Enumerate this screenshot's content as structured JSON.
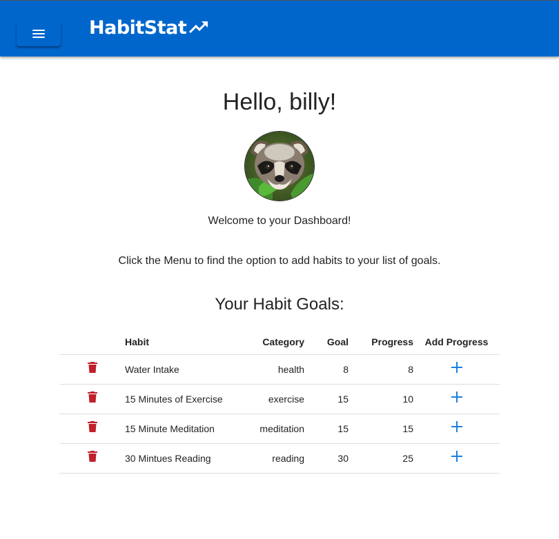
{
  "app": {
    "brand": "HabitStat",
    "brand_color": "#0066cc",
    "menu_icon": "menu-icon",
    "brand_icon": "trending-up-icon"
  },
  "dashboard": {
    "greeting": "Hello, billy!",
    "welcome": "Welcome to your Dashboard!",
    "instruction": "Click the Menu to find the option to add habits to your list of goals.",
    "goals_heading": "Your Habit Goals:"
  },
  "table": {
    "headers": {
      "habit": "Habit",
      "category": "Category",
      "goal": "Goal",
      "progress": "Progress",
      "add_progress": "Add Progress"
    },
    "delete_icon": "trash-icon",
    "delete_color": "#c0202a",
    "add_icon": "plus-icon",
    "add_color": "#1a7fe0",
    "rows": [
      {
        "habit": "Water Intake",
        "category": "health",
        "goal": "8",
        "progress": "8"
      },
      {
        "habit": "15 Minutes of Exercise",
        "category": "exercise",
        "goal": "15",
        "progress": "10"
      },
      {
        "habit": "15 Minute Meditation",
        "category": "meditation",
        "goal": "15",
        "progress": "15"
      },
      {
        "habit": "30 Mintues Reading",
        "category": "reading",
        "goal": "30",
        "progress": "25"
      }
    ]
  }
}
